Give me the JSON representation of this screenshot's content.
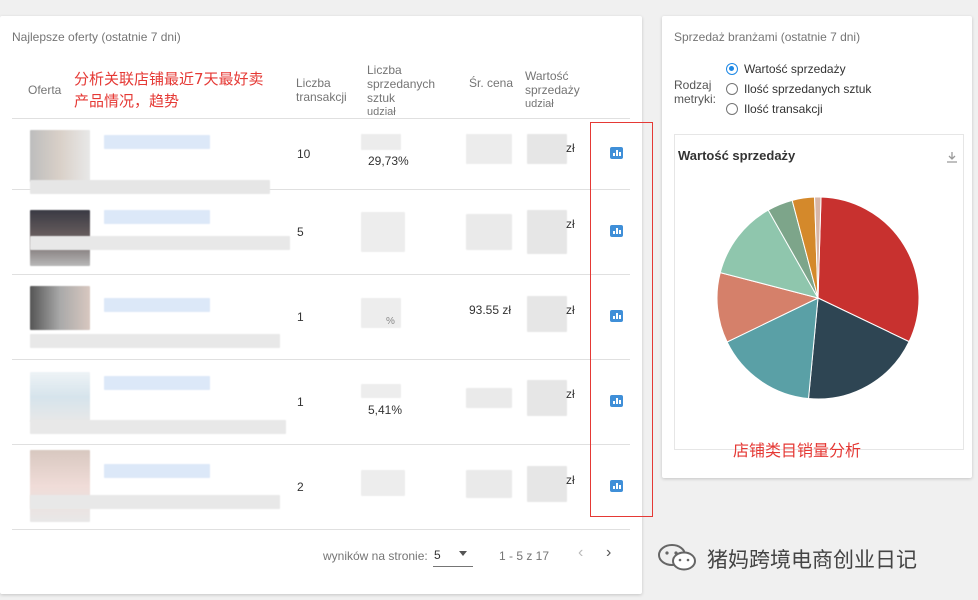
{
  "left_panel": {
    "title": "Najlepsze oferty (ostatnie 7 dni)",
    "columns": {
      "offer": "Oferta",
      "transactions": "Liczba transakcji",
      "sold_units_1": "Liczba sprzedanych sztuk",
      "sold_units_2": "udział",
      "avg_price": "Śr. cena",
      "sales_value_1": "Wartość sprzedaży",
      "sales_value_2": "udział"
    },
    "rows": [
      {
        "transactions": "10",
        "units_share": "29,73%",
        "avg_price": "",
        "value": "zł"
      },
      {
        "transactions": "5",
        "units_share": "",
        "avg_price": "",
        "value": "zł"
      },
      {
        "transactions": "1",
        "units_share": "%",
        "avg_price": "93.55 zł",
        "value": "zł"
      },
      {
        "transactions": "1",
        "units_share": "5,41%",
        "avg_price": "",
        "value": "zł"
      },
      {
        "transactions": "2",
        "units_share": "",
        "avg_price": "",
        "value": "zł"
      }
    ],
    "pagination": {
      "per_page_label": "wyników na stronie:",
      "per_page_value": "5",
      "range": "1 - 5 z 17"
    }
  },
  "right_panel": {
    "title": "Sprzedaż branżami (ostatnie 7 dni)",
    "metric_label_1": "Rodzaj",
    "metric_label_2": "metryki:",
    "options": [
      {
        "label": "Wartość sprzedaży",
        "selected": true
      },
      {
        "label": "Ilość sprzedanych sztuk",
        "selected": false
      },
      {
        "label": "Ilość transakcji",
        "selected": false
      }
    ],
    "chart_title": "Wartość sprzedaży"
  },
  "annotations": {
    "top_line1": "分析关联店铺最近7天最好卖",
    "top_line2": "产品情况，趋势",
    "bottom": "店铺类目销量分析",
    "watermark": "猪妈跨境电商创业日记"
  },
  "chart_data": {
    "type": "pie",
    "title": "Wartość sprzedaży",
    "slices": [
      {
        "value": 31.0,
        "color": "#c8312f"
      },
      {
        "value": 19.0,
        "color": "#2e4553"
      },
      {
        "value": 16.0,
        "color": "#5aa0a6"
      },
      {
        "value": 11.0,
        "color": "#d5806a"
      },
      {
        "value": 12.5,
        "color": "#8fc6ad"
      },
      {
        "value": 4.0,
        "color": "#7da58a"
      },
      {
        "value": 3.5,
        "color": "#d4892b"
      },
      {
        "value": 1.0,
        "color": "#d8b6a6"
      }
    ]
  }
}
